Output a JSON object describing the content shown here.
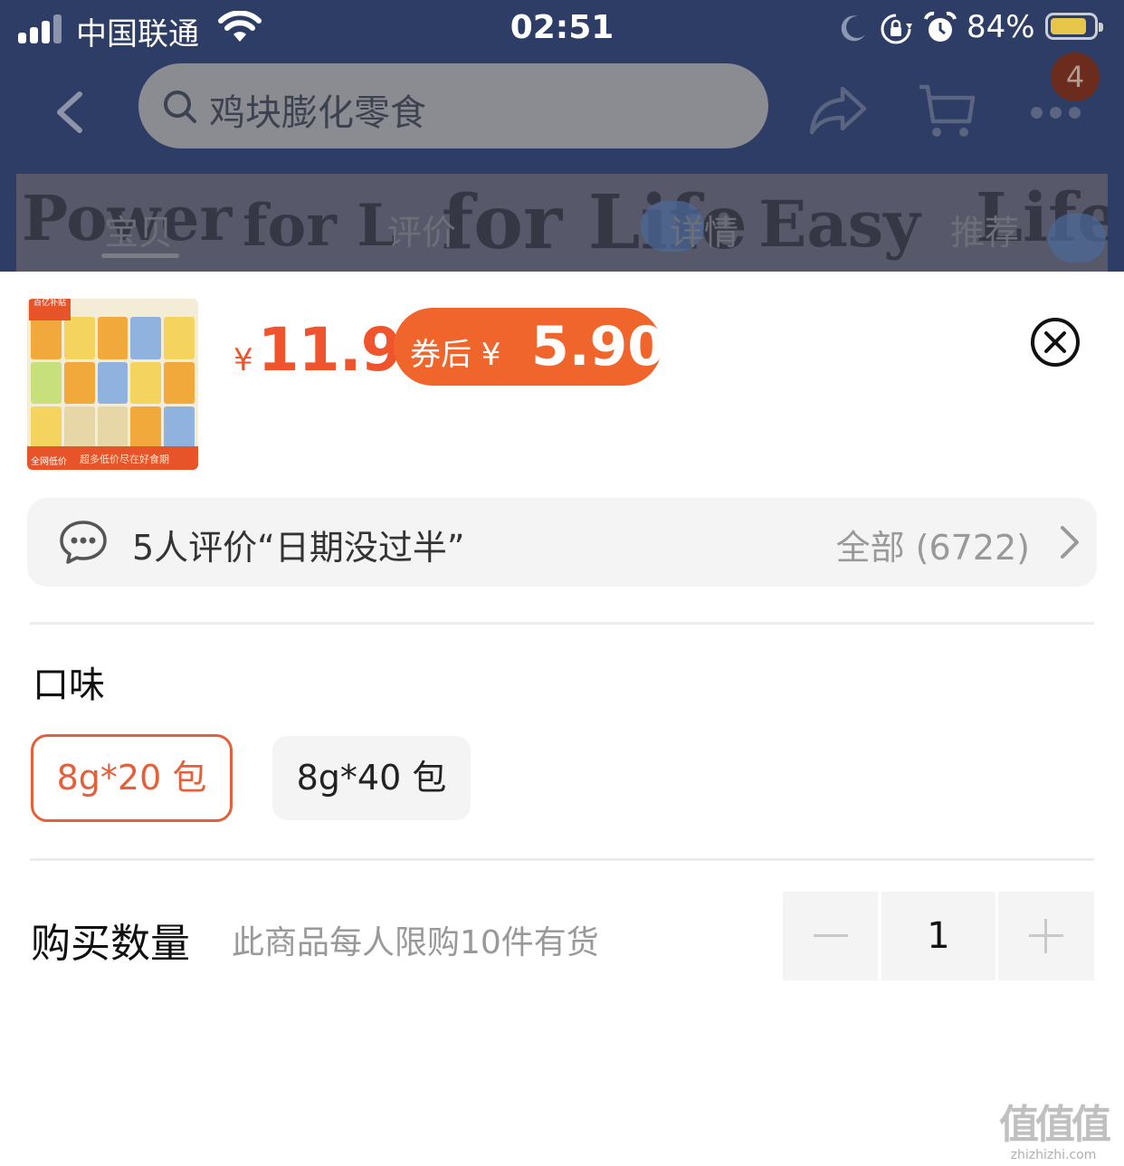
{
  "status_bar": {
    "carrier": "中国联通",
    "time": "02:51",
    "battery_percent": "84%",
    "battery_level": 0.84
  },
  "nav": {
    "search_placeholder": "鸡块膨化零食",
    "cart_badge": "4"
  },
  "tabs": [
    "宝贝",
    "评价",
    "详情",
    "推荐"
  ],
  "active_tab_index": 0,
  "product": {
    "thumbnail_tag": "百亿补贴",
    "thumbnail_corner": "全网低价",
    "thumbnail_footer": "超多低价尽在好食期",
    "price_symbol": "¥",
    "price": "11.9",
    "coupon_label": "券后 ¥",
    "coupon_price": "5.90"
  },
  "review": {
    "summary": "5人评价“日期没过半”",
    "all_label": "全部 (6722)"
  },
  "flavor": {
    "title": "口味",
    "options": [
      {
        "label": "8g*20 包",
        "selected": true
      },
      {
        "label": "8g*40 包",
        "selected": false
      }
    ]
  },
  "quantity": {
    "title": "购买数量",
    "hint": "此商品每人限购10件有货",
    "value": "1"
  },
  "watermark": {
    "mark": "值值值",
    "domain": "zhizhizhi.com"
  },
  "colors": {
    "accent": "#f0542c",
    "coupon_bg": "#f0652b",
    "nav_bg": "#2e3d66"
  }
}
